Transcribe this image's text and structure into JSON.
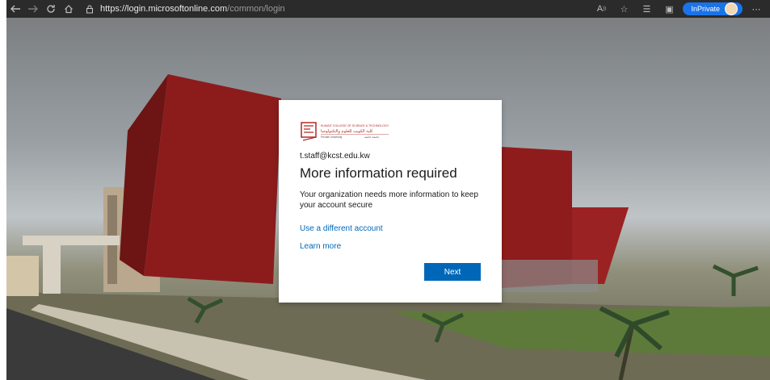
{
  "browser": {
    "url_host": "https://login.microsoftonline.com",
    "url_path": "/common/login",
    "inprivate_label": "InPrivate",
    "icons": [
      "back-icon",
      "forward-icon",
      "refresh-icon",
      "home-icon",
      "lock-icon",
      "read-aloud-icon",
      "add-favorite-icon",
      "favorites-icon",
      "collections-icon",
      "profile-icon",
      "more-icon"
    ]
  },
  "card": {
    "logo_text_en": "KUWAIT COLLEGE OF SCIENCE & TECHNOLOGY",
    "logo_text_ar": "كلية الكويت للعلوم والتكنولوجيا",
    "logo_sub_en": "Private University",
    "logo_sub_ar": "جامعة خاصة",
    "email": "t.staff@kcst.edu.kw",
    "title": "More information required",
    "description": "Your organization needs more information to keep your account secure",
    "link_different_account": "Use a different account",
    "link_learn_more": "Learn more",
    "next_label": "Next"
  },
  "colors": {
    "accent": "#0067b8",
    "logo_red": "#b32824",
    "inprivate_badge": "#1a73e8"
  }
}
